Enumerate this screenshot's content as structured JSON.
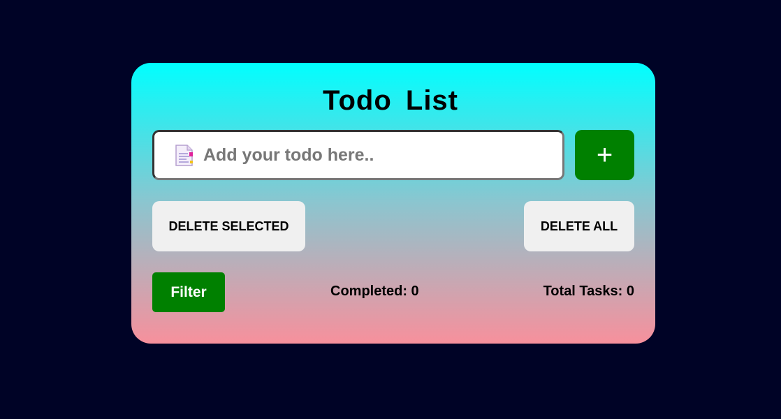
{
  "app": {
    "title": "Todo List"
  },
  "input": {
    "placeholder": "Add your todo here..",
    "value": "",
    "icon": "document-icon"
  },
  "buttons": {
    "add_label": "+",
    "delete_selected_label": "DELETE SELECTED",
    "delete_all_label": "DELETE ALL",
    "filter_label": "Filter"
  },
  "stats": {
    "completed_label": "Completed: 0",
    "total_label": "Total Tasks: 0"
  },
  "colors": {
    "page_background": "#000326",
    "gradient_top": "#00ffff",
    "gradient_bottom": "#f7909c",
    "accent_green": "#008000",
    "secondary_button": "#f0f0f0"
  }
}
